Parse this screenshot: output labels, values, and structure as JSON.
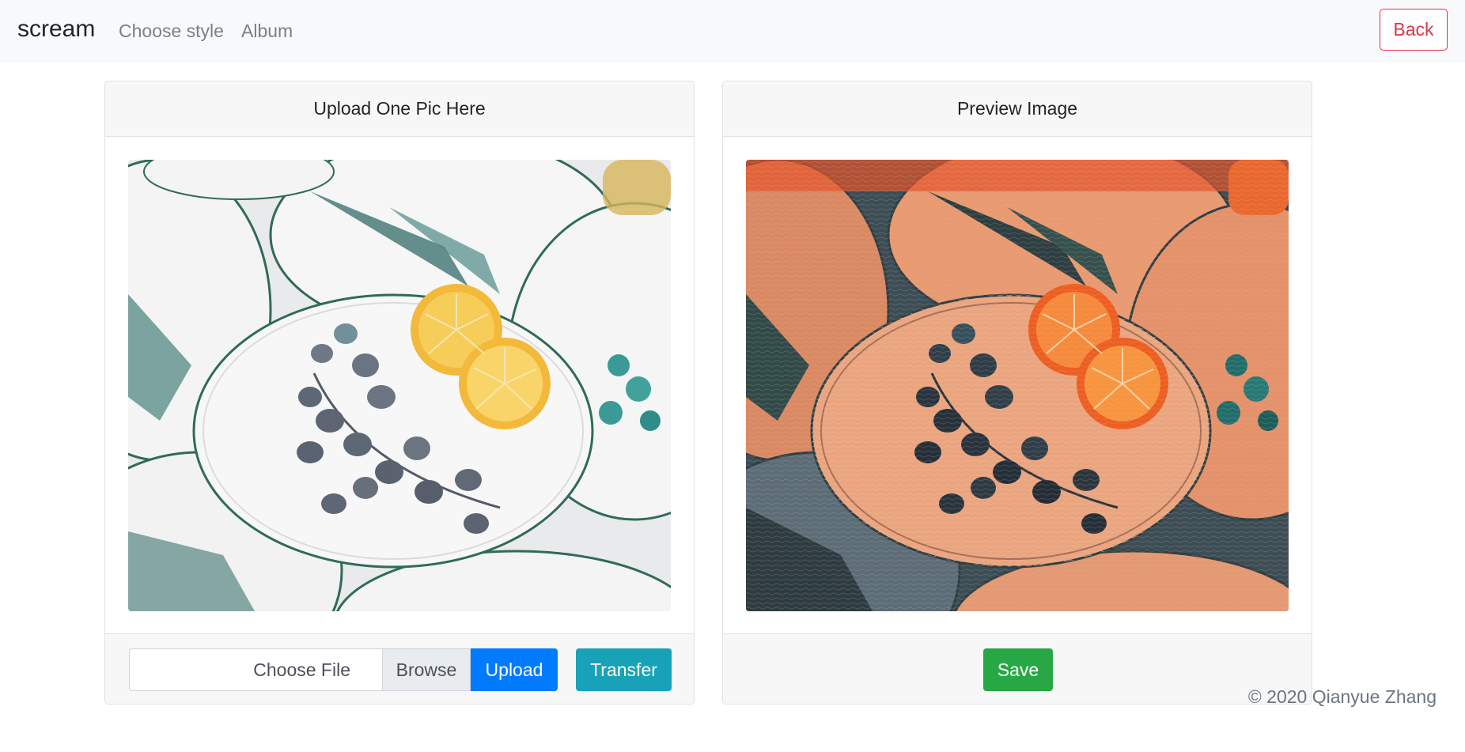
{
  "navbar": {
    "brand": "scream",
    "links": [
      "Choose style",
      "Album"
    ],
    "back_label": "Back"
  },
  "upload_card": {
    "header": "Upload One Pic Here",
    "file_label": "Choose File",
    "browse_label": "Browse",
    "upload_label": "Upload",
    "transfer_label": "Transfer"
  },
  "preview_card": {
    "header": "Preview Image",
    "save_label": "Save"
  },
  "footer": {
    "copyright": "© 2020 Qianyue Zhang"
  },
  "colors": {
    "primary": "#007bff",
    "info": "#17a2b8",
    "success": "#28a745",
    "danger": "#dc3545",
    "navbar_bg": "#f8f9fa"
  }
}
